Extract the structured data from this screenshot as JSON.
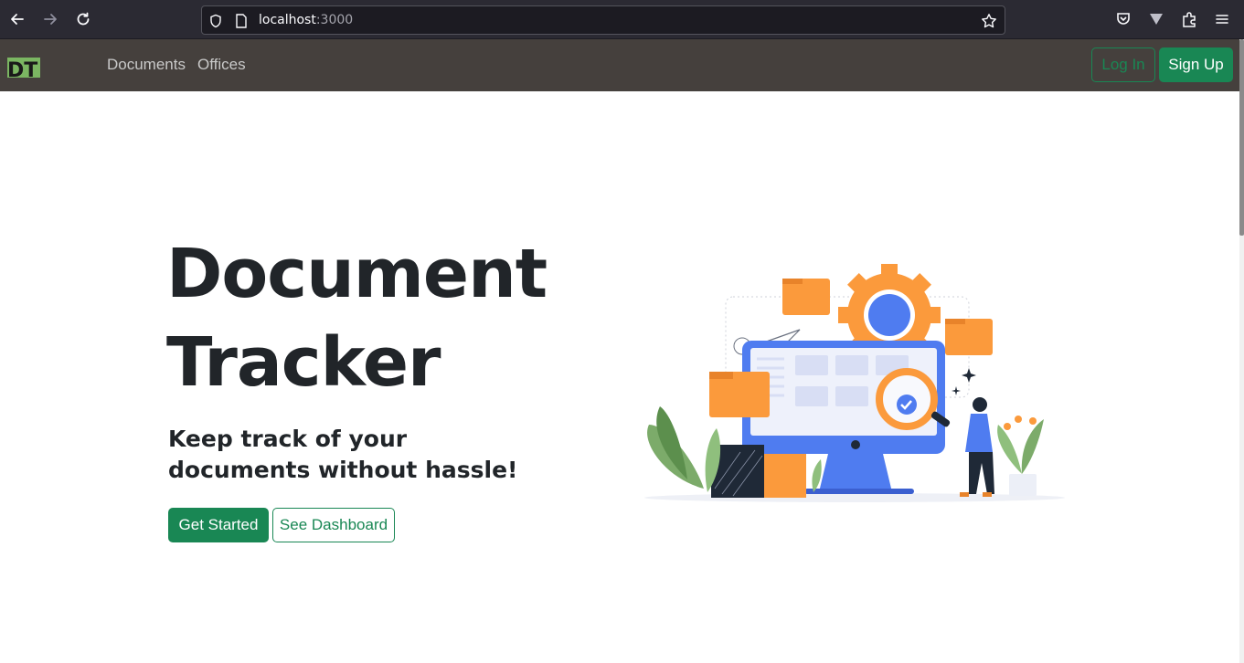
{
  "browser": {
    "url_host": "localhost",
    "url_port": ":3000"
  },
  "navbar": {
    "logo_text": "DT",
    "links": [
      "Documents",
      "Offices"
    ],
    "login_label": "Log In",
    "signup_label": "Sign Up"
  },
  "hero": {
    "title_line1": "Document",
    "title_line2": "Tracker",
    "subtitle": "Keep track of your documents without hassle!",
    "get_started_label": "Get Started",
    "see_dashboard_label": "See Dashboard"
  },
  "colors": {
    "primary": "#198754",
    "navbar_bg": "#45403d",
    "accent_orange": "#fb9a3c",
    "accent_blue": "#4f7cf0"
  }
}
